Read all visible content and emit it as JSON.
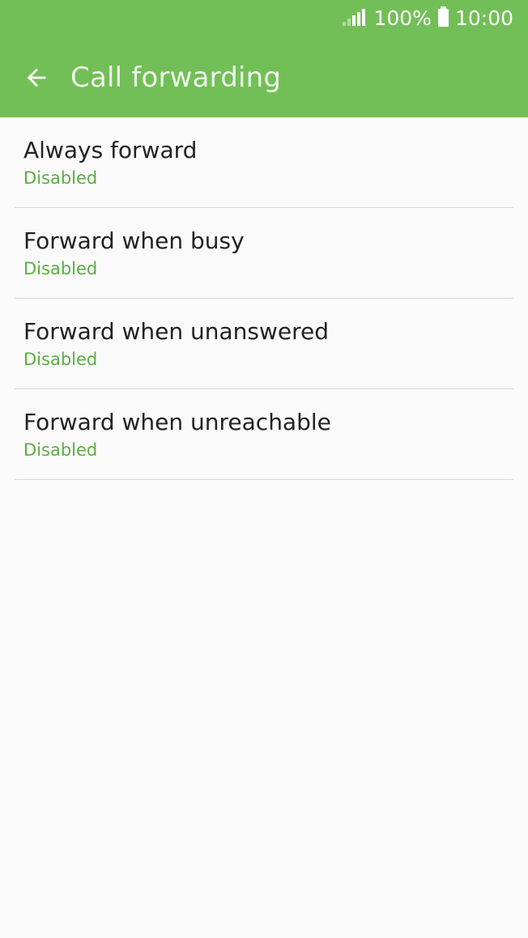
{
  "status_bar": {
    "battery_percent": "100%",
    "time": "10:00",
    "icons": [
      "signal-icon",
      "battery-icon"
    ]
  },
  "toolbar": {
    "back_icon": "arrow-left-icon",
    "title": "Call forwarding"
  },
  "colors": {
    "header_bg": "#72bf57",
    "summary_text": "#5cae43",
    "page_bg": "#fafafa"
  },
  "settings": {
    "items": [
      {
        "title": "Always forward",
        "summary": "Disabled"
      },
      {
        "title": "Forward when busy",
        "summary": "Disabled"
      },
      {
        "title": "Forward when unanswered",
        "summary": "Disabled"
      },
      {
        "title": "Forward when unreachable",
        "summary": "Disabled"
      }
    ]
  }
}
